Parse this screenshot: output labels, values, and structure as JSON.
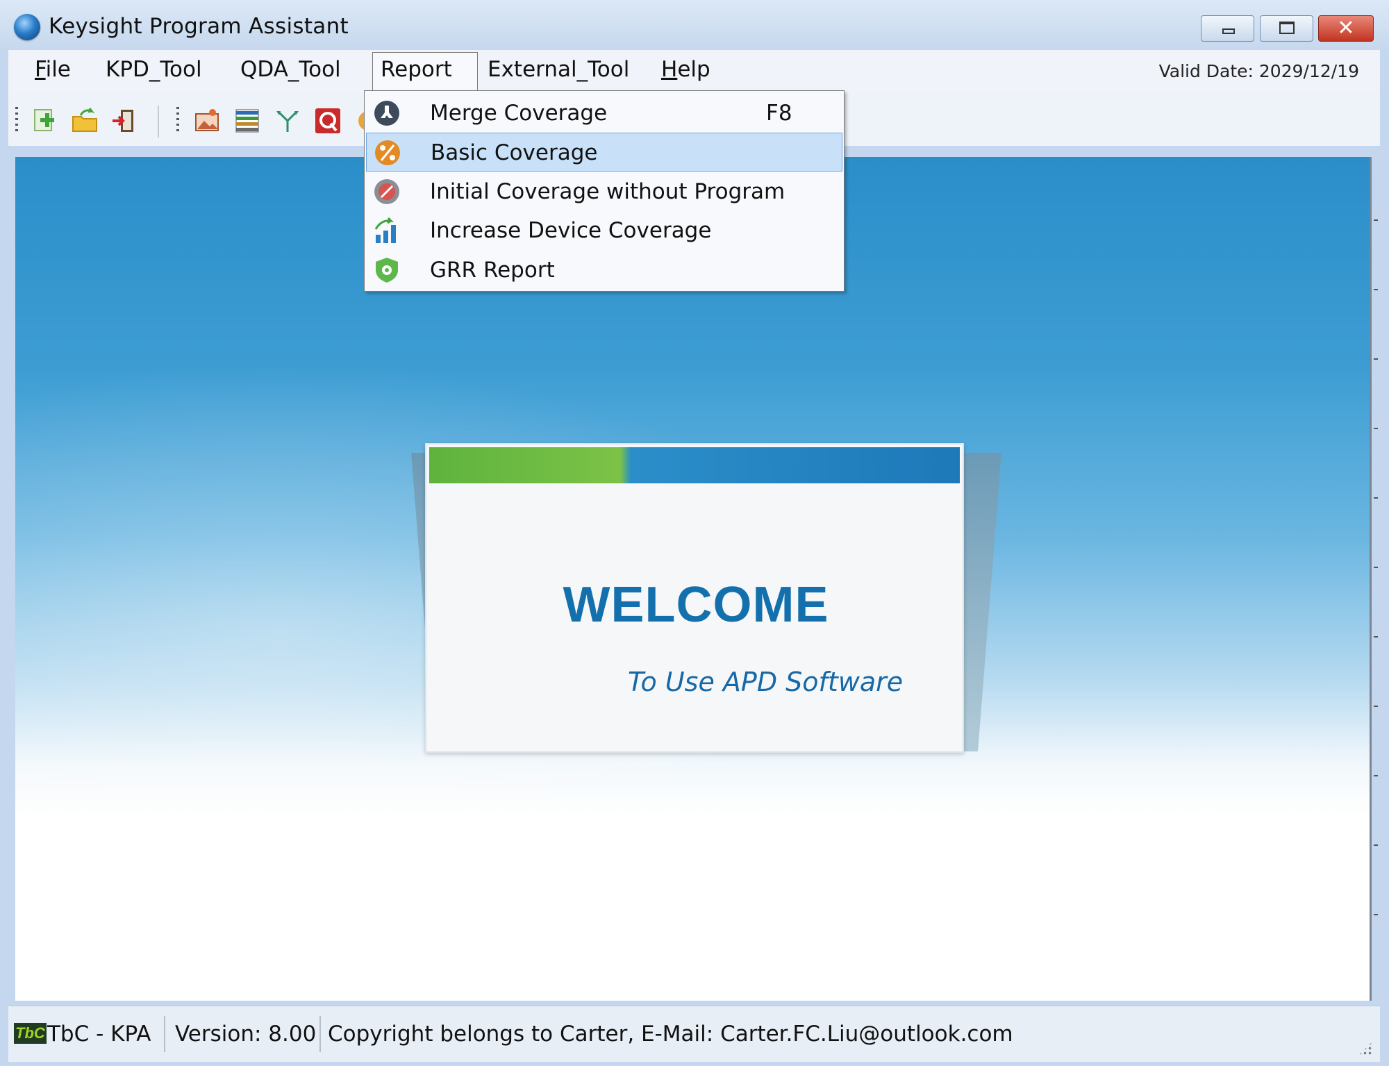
{
  "window": {
    "title": "Keysight Program Assistant",
    "icon": "globe-app-icon",
    "buttons": [
      "minimize-icon",
      "maximize-icon",
      "close-icon"
    ],
    "close_glyph": "✕"
  },
  "menubar": {
    "items": [
      {
        "label": "File",
        "mnemonic": "F",
        "rest": "ile"
      },
      {
        "label": "KPD_Tool"
      },
      {
        "label": "QDA_Tool"
      },
      {
        "label": "Report",
        "open": true
      },
      {
        "label": "External_Tool"
      },
      {
        "label": "Help",
        "mnemonic": "H",
        "rest": "elp"
      }
    ],
    "valid_date": "Valid Date: 2029/12/19"
  },
  "toolbar": {
    "icons": [
      "new-icon",
      "open-folder-icon",
      "exit-icon",
      "photo-edit-icon",
      "list-icon",
      "branch-icon",
      "q-icon",
      "coverage-icon"
    ]
  },
  "report_menu": {
    "items": [
      {
        "label": "Merge Coverage",
        "shortcut": "F8",
        "icon": "merge-icon"
      },
      {
        "label": "Basic Coverage",
        "icon": "percent-icon",
        "highlighted": true
      },
      {
        "label": "Initial Coverage without Program",
        "icon": "initial-coverage-icon"
      },
      {
        "label": "Increase Device Coverage",
        "icon": "increase-chart-icon"
      },
      {
        "label": "GRR Report",
        "icon": "shield-icon"
      }
    ]
  },
  "welcome": {
    "title": "WELCOME",
    "subtitle": "To Use APD Software"
  },
  "statusbar": {
    "logo": "TbC",
    "app": "TbC - KPA",
    "version": "Version: 8.00",
    "copyright": "Copyright belongs to Carter, E-Mail: Carter.FC.Liu@outlook.com"
  },
  "colors": {
    "accent_blue": "#1470ad",
    "menu_highlight": "#c8e1f9",
    "progress_green": "#7cc247"
  }
}
